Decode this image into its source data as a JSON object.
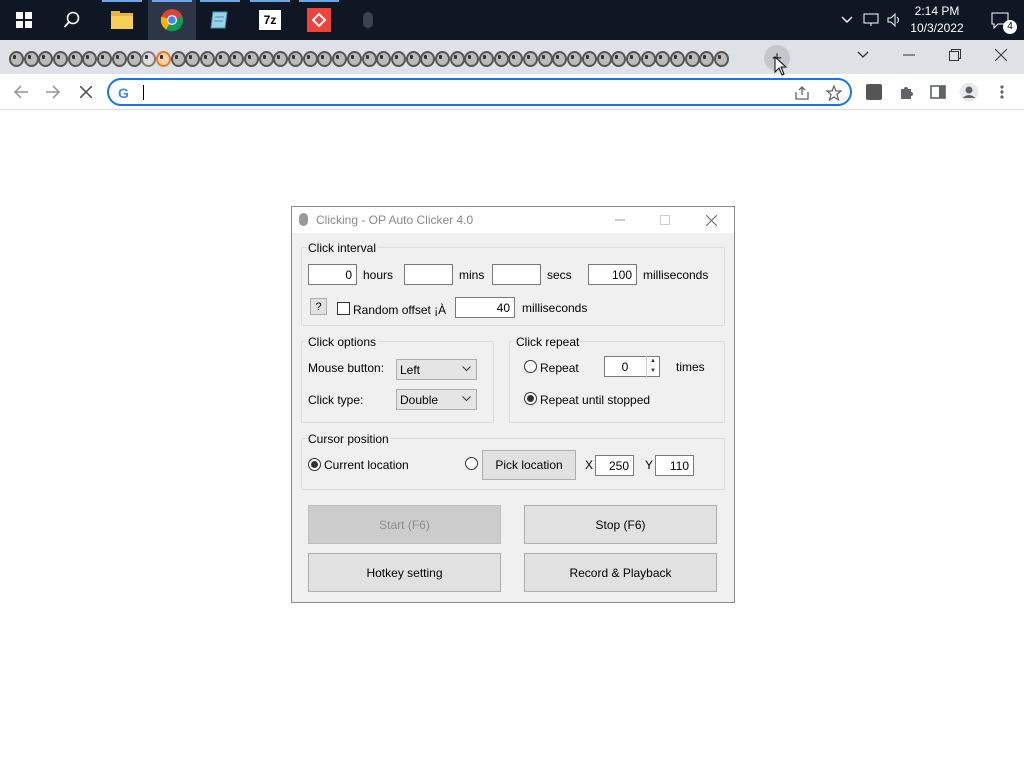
{
  "taskbar": {
    "clock_time": "2:14 PM",
    "clock_date": "10/3/2022",
    "notification_count": "4",
    "icons": [
      "windows-start-icon",
      "search-icon",
      "file-explorer-icon",
      "chrome-icon",
      "notepad-icon",
      "7zip-icon",
      "anydesk-icon",
      "mouse-icon"
    ]
  },
  "browser": {
    "tab_count_icons": 49,
    "new_tab_symbol": "+",
    "omnibox_value": "",
    "google_letter": "G"
  },
  "dialog": {
    "title": "Clicking - OP Auto Clicker 4.0",
    "click_interval": {
      "legend": "Click interval",
      "hours_value": "0",
      "hours_label": "hours",
      "mins_value": "",
      "mins_label": "mins",
      "secs_value": "",
      "secs_label": "secs",
      "ms_value": "100",
      "ms_label": "milliseconds",
      "help_label": "?",
      "random_offset_label": "Random offset ¡À",
      "random_offset_checked": false,
      "offset_value": "40",
      "offset_label": "milliseconds"
    },
    "click_options": {
      "legend": "Click options",
      "mouse_button_label": "Mouse button:",
      "mouse_button_value": "Left",
      "click_type_label": "Click type:",
      "click_type_value": "Double"
    },
    "click_repeat": {
      "legend": "Click repeat",
      "repeat_label": "Repeat",
      "repeat_value": "0",
      "times_label": "times",
      "repeat_until_stopped_label": "Repeat until stopped",
      "selected": "repeat_until_stopped"
    },
    "cursor_position": {
      "legend": "Cursor position",
      "current_location_label": "Current location",
      "pick_location_label": "Pick location",
      "x_label": "X",
      "x_value": "250",
      "y_label": "Y",
      "y_value": "110",
      "selected": "current_location"
    },
    "buttons": {
      "start": "Start (F6)",
      "stop": "Stop (F6)",
      "hotkey": "Hotkey setting",
      "record": "Record & Playback"
    }
  }
}
